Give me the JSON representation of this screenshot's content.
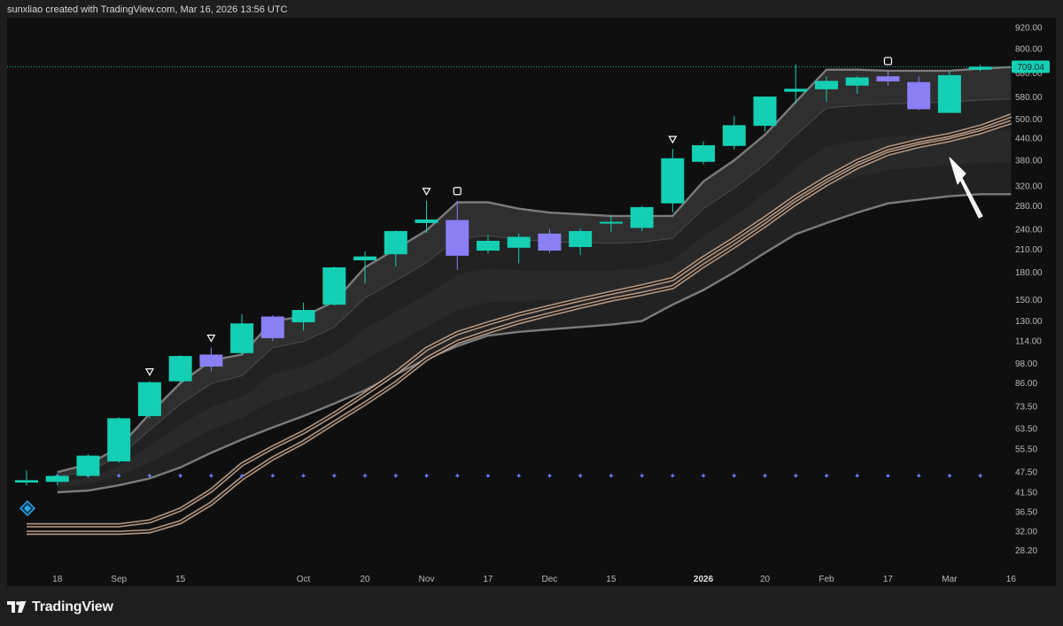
{
  "header": {
    "text": "sunxliao created with TradingView.com, Mar 16, 2026 13:56 UTC"
  },
  "footer": {
    "brand": "TradingView",
    "logo_icon": "tradingview-logo-icon"
  },
  "colors": {
    "up": "#14cfb4",
    "down": "#8a7ff5",
    "background": "#0f0f0f",
    "frame": "#1e1e1e",
    "last_price_bg": "#14cfb4",
    "last_price_line": "#26a69a",
    "band_outline": "#7c7c7c",
    "ma_glow": "#c8a78e",
    "dots": "#6b7cff",
    "marker_diamond": "#2aa8e8"
  },
  "chart_data": {
    "type": "candlestick",
    "scale": "log",
    "timeframe": "weekly",
    "last_price": {
      "value": 709.04,
      "label": "709.04"
    },
    "y_axis": {
      "ticks": [
        "920.00",
        "800.00",
        "680.00",
        "580.00",
        "500.00",
        "440.00",
        "380.00",
        "320.00",
        "280.00",
        "240.00",
        "210.00",
        "180.00",
        "150.00",
        "130.00",
        "114.00",
        "98.00",
        "86.00",
        "73.50",
        "63.50",
        "55.50",
        "47.50",
        "41.50",
        "36.50",
        "32.00",
        "28.20"
      ],
      "range": [
        26.5,
        960
      ]
    },
    "x_axis": {
      "ticks": [
        {
          "label": "18",
          "week": 1,
          "bold": false
        },
        {
          "label": "Sep",
          "week": 3,
          "bold": false
        },
        {
          "label": "15",
          "week": 5,
          "bold": false
        },
        {
          "label": "Oct",
          "week": 9,
          "bold": false
        },
        {
          "label": "20",
          "week": 11,
          "bold": false
        },
        {
          "label": "Nov",
          "week": 13,
          "bold": false
        },
        {
          "label": "17",
          "week": 15,
          "bold": false
        },
        {
          "label": "Dec",
          "week": 17,
          "bold": false
        },
        {
          "label": "15",
          "week": 19,
          "bold": false
        },
        {
          "label": "2026",
          "week": 22,
          "bold": true
        },
        {
          "label": "20",
          "week": 24,
          "bold": false
        },
        {
          "label": "Feb",
          "week": 26,
          "bold": false
        },
        {
          "label": "17",
          "week": 28,
          "bold": false
        },
        {
          "label": "Mar",
          "week": 30,
          "bold": false
        },
        {
          "label": "16",
          "week": 32,
          "bold": false
        }
      ]
    },
    "candles": [
      {
        "o": 44.3,
        "h": 48.0,
        "l": 43.5,
        "c": 45.0
      },
      {
        "o": 44.5,
        "h": 46.8,
        "l": 43.5,
        "c": 46.3
      },
      {
        "o": 46.3,
        "h": 53.5,
        "l": 46.0,
        "c": 53.0
      },
      {
        "o": 51.0,
        "h": 68.5,
        "l": 50.5,
        "c": 68.0
      },
      {
        "o": 69.0,
        "h": 87.0,
        "l": 68.0,
        "c": 86.5
      },
      {
        "o": 87.0,
        "h": 103.5,
        "l": 86.0,
        "c": 103.0
      },
      {
        "o": 104.0,
        "h": 109.0,
        "l": 93.0,
        "c": 96.0
      },
      {
        "o": 105.0,
        "h": 136.0,
        "l": 104.0,
        "c": 128.0
      },
      {
        "o": 134.0,
        "h": 135.0,
        "l": 114.0,
        "c": 116.0
      },
      {
        "o": 129.0,
        "h": 147.0,
        "l": 122.0,
        "c": 140.0
      },
      {
        "o": 145.0,
        "h": 187.0,
        "l": 144.0,
        "c": 186.0
      },
      {
        "o": 195.0,
        "h": 207.0,
        "l": 167.0,
        "c": 200.0
      },
      {
        "o": 203.0,
        "h": 238.0,
        "l": 187.0,
        "c": 237.0
      },
      {
        "o": 250.0,
        "h": 290.0,
        "l": 234.0,
        "c": 256.0
      },
      {
        "o": 255.0,
        "h": 290.0,
        "l": 183.0,
        "c": 201.0
      },
      {
        "o": 208.0,
        "h": 231.0,
        "l": 204.0,
        "c": 222.0
      },
      {
        "o": 212.0,
        "h": 233.0,
        "l": 191.0,
        "c": 228.0
      },
      {
        "o": 233.0,
        "h": 240.0,
        "l": 205.0,
        "c": 208.0
      },
      {
        "o": 213.0,
        "h": 241.0,
        "l": 202.0,
        "c": 237.0
      },
      {
        "o": 251.0,
        "h": 262.0,
        "l": 236.0,
        "c": 252.0
      },
      {
        "o": 242.0,
        "h": 280.0,
        "l": 237.0,
        "c": 278.0
      },
      {
        "o": 285.0,
        "h": 410.0,
        "l": 268.0,
        "c": 385.0
      },
      {
        "o": 376.0,
        "h": 431.0,
        "l": 370.0,
        "c": 420.0
      },
      {
        "o": 418.0,
        "h": 510.0,
        "l": 408.0,
        "c": 480.0
      },
      {
        "o": 478.0,
        "h": 582.0,
        "l": 460.0,
        "c": 581.0
      },
      {
        "o": 600.0,
        "h": 720.0,
        "l": 555.0,
        "c": 612.0
      },
      {
        "o": 610.0,
        "h": 665.0,
        "l": 560.0,
        "c": 645.0
      },
      {
        "o": 625.0,
        "h": 665.0,
        "l": 592.0,
        "c": 660.0
      },
      {
        "o": 665.0,
        "h": 690.0,
        "l": 625.0,
        "c": 643.0
      },
      {
        "o": 640.0,
        "h": 665.0,
        "l": 530.0,
        "c": 534.0
      },
      {
        "o": 521.0,
        "h": 690.0,
        "l": 521.0,
        "c": 670.0
      },
      {
        "o": 695.0,
        "h": 718.0,
        "l": 688.0,
        "c": 709.0
      }
    ],
    "overlays": {
      "upper_band": [
        null,
        47.5,
        50,
        56,
        70,
        86,
        100,
        104,
        130,
        134,
        148,
        186,
        210,
        238,
        287,
        287,
        275,
        268,
        265,
        262,
        262,
        262,
        330,
        380,
        450,
        560,
        695,
        695,
        690,
        690,
        690,
        700,
        707
      ],
      "lower_band": [
        null,
        41.5,
        42.0,
        43.5,
        45.5,
        49.0,
        54.0,
        59.0,
        64.0,
        69.0,
        75.0,
        82.0,
        91.0,
        101.0,
        110.0,
        118.0,
        121.0,
        123.0,
        125.0,
        127.0,
        130.0,
        145.0,
        160.0,
        180.0,
        205.0,
        232.0,
        250.0,
        268.0,
        285.0,
        292.0,
        299.0,
        303.0,
        303.0
      ],
      "ma_fast": [
        33.3,
        33.3,
        33.3,
        33.3,
        34.2,
        37.0,
        42.0,
        50.0,
        56.0,
        62.0,
        70.0,
        80.0,
        92.0,
        108.0,
        120.0,
        128.0,
        136.0,
        143.0,
        150.0,
        157.0,
        164.0,
        172.0,
        198.0,
        225.0,
        258.0,
        298.0,
        338.0,
        378.0,
        412.0,
        433.0,
        450.0,
        475.0,
        512.0
      ],
      "ma_slow": [
        31.7,
        31.7,
        31.7,
        31.7,
        32.0,
        34.0,
        38.5,
        45.5,
        52.0,
        58.0,
        66.0,
        75.0,
        86.0,
        101.0,
        113.0,
        121.0,
        129.0,
        136.0,
        143.0,
        150.0,
        156.0,
        163.0,
        188.0,
        214.0,
        246.0,
        285.0,
        324.0,
        363.0,
        397.0,
        418.0,
        435.0,
        458.0,
        490.0
      ],
      "dots_level": 46.5,
      "triangle_markers_weeks": [
        4,
        6,
        13,
        21
      ],
      "square_markers_weeks": [
        14,
        28
      ],
      "diamond_marker": {
        "week": 0,
        "value": 37.3
      }
    },
    "annotations": [
      {
        "type": "arrow",
        "direction": "up-left",
        "color": "#ffffff"
      }
    ],
    "grid": false
  }
}
